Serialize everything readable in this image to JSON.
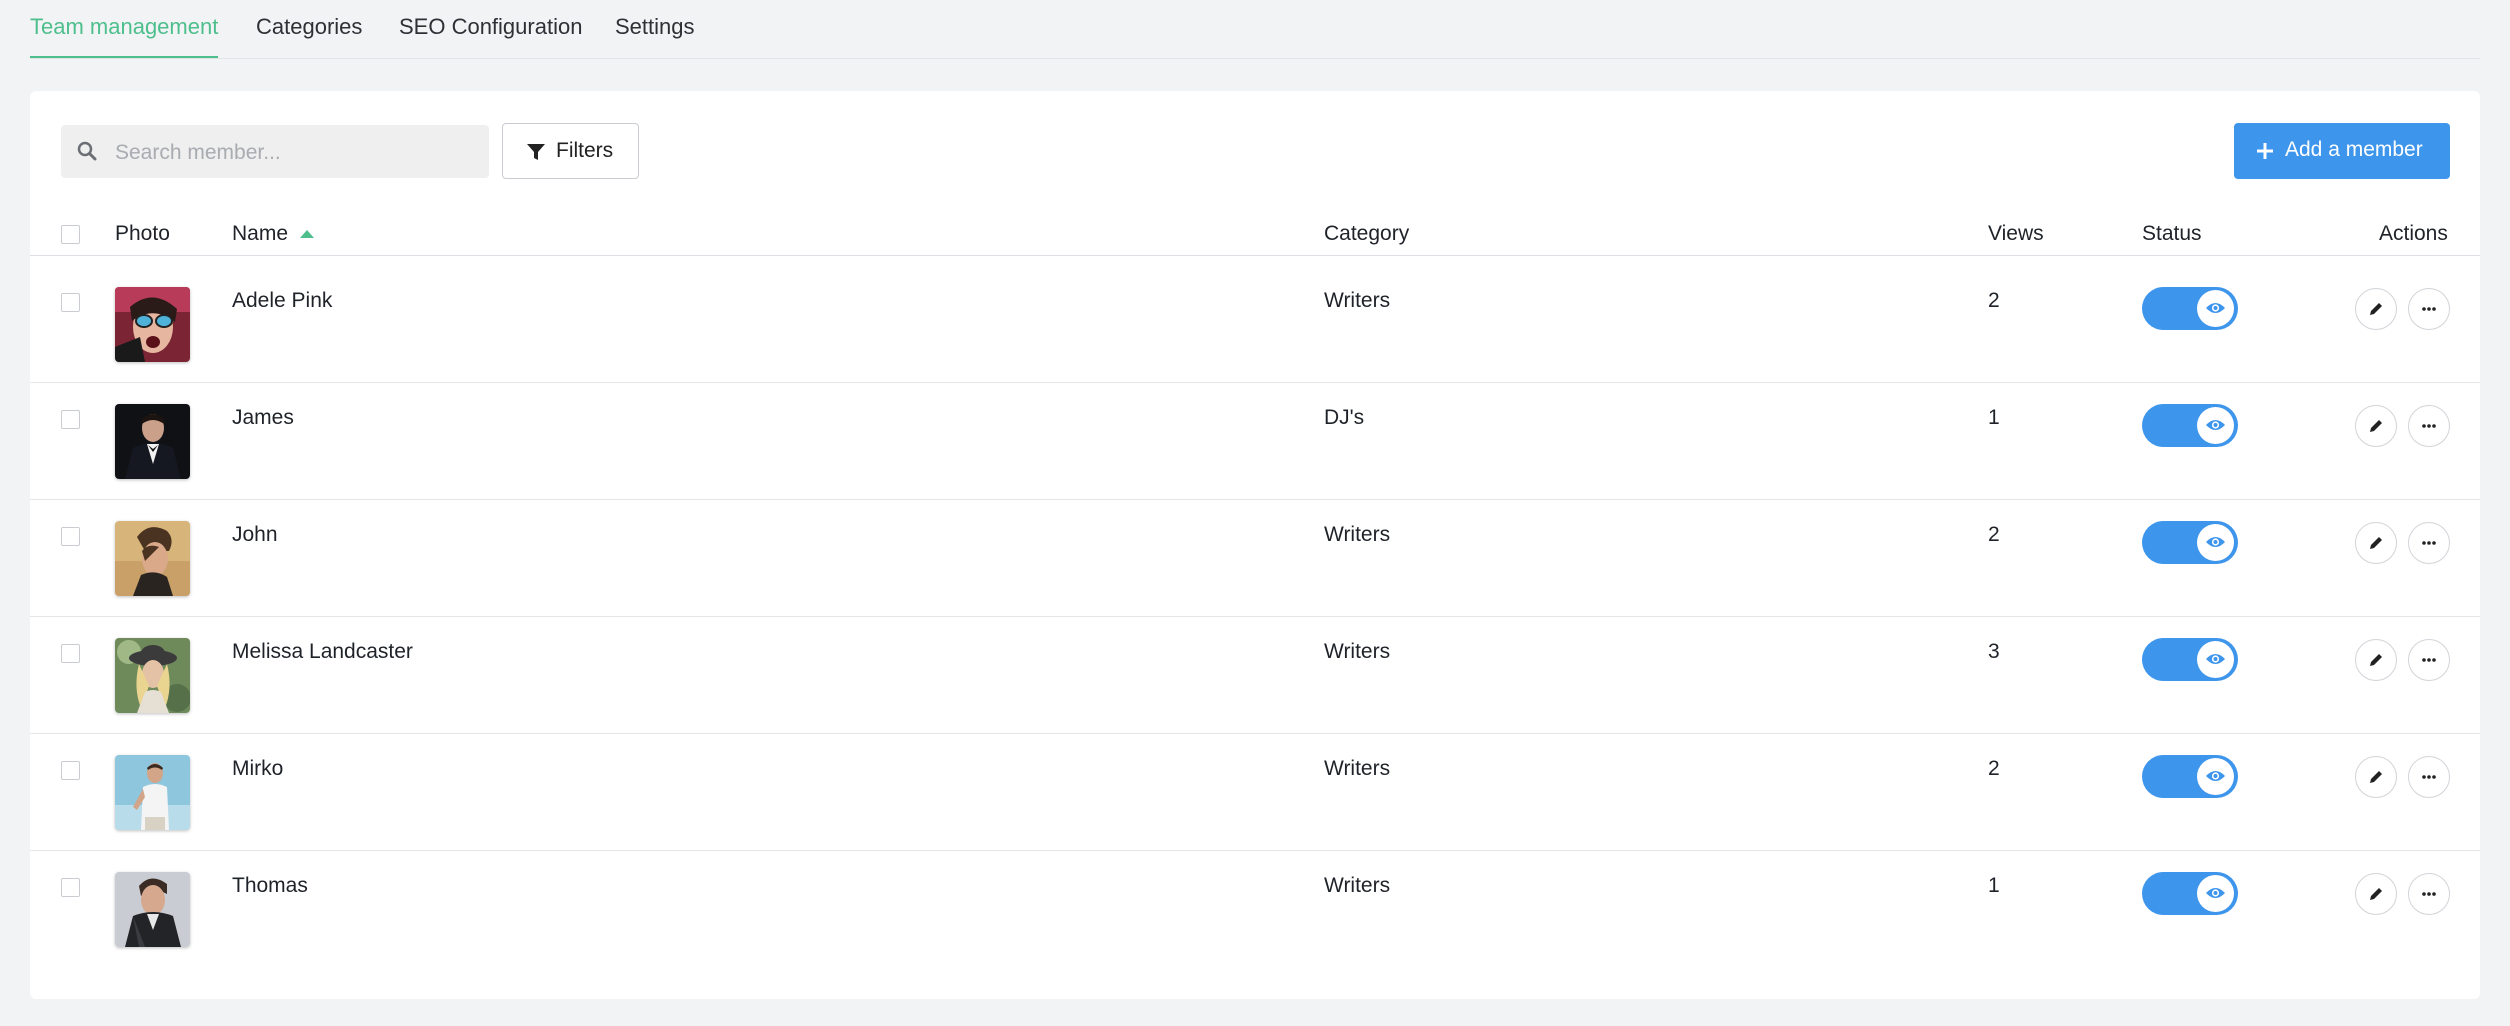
{
  "tabs": [
    {
      "label": "Team management",
      "active": true
    },
    {
      "label": "Categories",
      "active": false
    },
    {
      "label": "SEO Configuration",
      "active": false
    },
    {
      "label": "Settings",
      "active": false
    }
  ],
  "toolbar": {
    "search_placeholder": "Search member...",
    "search_value": "",
    "filters_label": "Filters",
    "add_label": "Add a member"
  },
  "table": {
    "headers": {
      "photo": "Photo",
      "name": "Name",
      "category": "Category",
      "views": "Views",
      "status": "Status",
      "actions": "Actions"
    },
    "sort": {
      "column": "name",
      "direction": "asc"
    },
    "rows": [
      {
        "name": "Adele Pink",
        "category": "Writers",
        "views": "2",
        "status_on": true,
        "avatar": "photo-woman-sunglasses"
      },
      {
        "name": "James",
        "category": "DJ's",
        "views": "1",
        "status_on": true,
        "avatar": "photo-man-tuxedo"
      },
      {
        "name": "John",
        "category": "Writers",
        "views": "2",
        "status_on": true,
        "avatar": "photo-man-profile"
      },
      {
        "name": "Melissa Landcaster",
        "category": "Writers",
        "views": "3",
        "status_on": true,
        "avatar": "photo-woman-hat"
      },
      {
        "name": "Mirko",
        "category": "Writers",
        "views": "2",
        "status_on": true,
        "avatar": "photo-man-sky"
      },
      {
        "name": "Thomas",
        "category": "Writers",
        "views": "1",
        "status_on": true,
        "avatar": "photo-man-jacket"
      }
    ]
  },
  "colors": {
    "accent_green": "#4dbf8c",
    "primary_blue": "#3d95ec",
    "page_bg": "#f2f3f5"
  }
}
